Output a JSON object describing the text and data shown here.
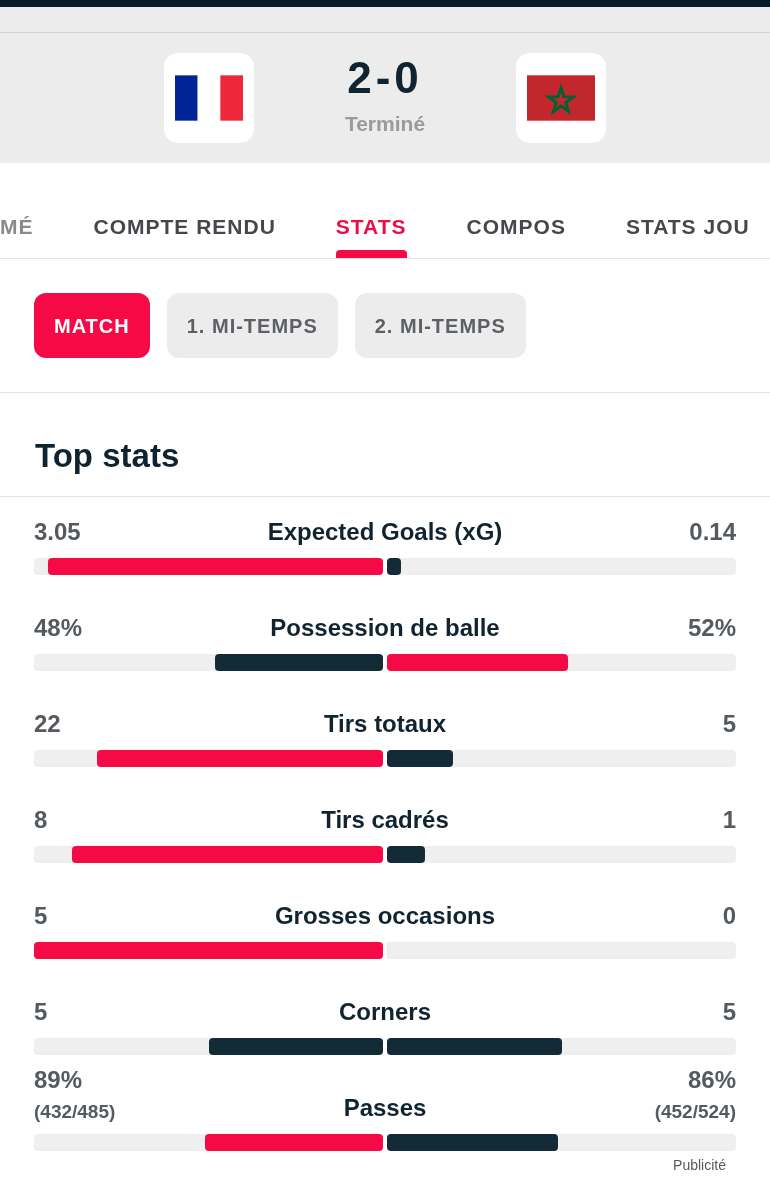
{
  "match": {
    "score": "2-0",
    "status": "Terminé"
  },
  "tabs": [
    {
      "label": "MÉ",
      "selected": false
    },
    {
      "label": "COMPTE RENDU",
      "selected": false
    },
    {
      "label": "STATS",
      "selected": true
    },
    {
      "label": "COMPOS",
      "selected": false
    },
    {
      "label": "STATS JOU",
      "selected": false
    }
  ],
  "periods": [
    {
      "label": "MATCH",
      "selected": true
    },
    {
      "label": "1. MI-TEMPS",
      "selected": false
    },
    {
      "label": "2. MI-TEMPS",
      "selected": false
    }
  ],
  "section_title": "Top stats",
  "stats": [
    {
      "name": "Expected Goals (xG)",
      "home": {
        "value": "3.05",
        "level": 0.96
      },
      "away": {
        "value": "0.14",
        "level": 0.04
      }
    },
    {
      "name": "Possession de balle",
      "home": {
        "value": "48%",
        "level": 0.48
      },
      "away": {
        "value": "52%",
        "level": 0.52
      }
    },
    {
      "name": "Tirs totaux",
      "home": {
        "value": "22",
        "level": 0.82
      },
      "away": {
        "value": "5",
        "level": 0.19
      }
    },
    {
      "name": "Tirs cadrés",
      "home": {
        "value": "8",
        "level": 0.89
      },
      "away": {
        "value": "1",
        "level": 0.11
      }
    },
    {
      "name": "Grosses occasions",
      "home": {
        "value": "5",
        "level": 1
      },
      "away": {
        "value": "0",
        "level": 0
      }
    },
    {
      "name": "Corners",
      "home": {
        "value": "5",
        "level": 0.5
      },
      "away": {
        "value": "5",
        "level": 0.5
      }
    },
    {
      "name": "Passes",
      "home": {
        "value": "89%",
        "detail": "(432/485)",
        "level": 0.51
      },
      "away": {
        "value": "86%",
        "detail": "(452/524)",
        "level": 0.49
      }
    }
  ],
  "ad_label": "Publicité"
}
